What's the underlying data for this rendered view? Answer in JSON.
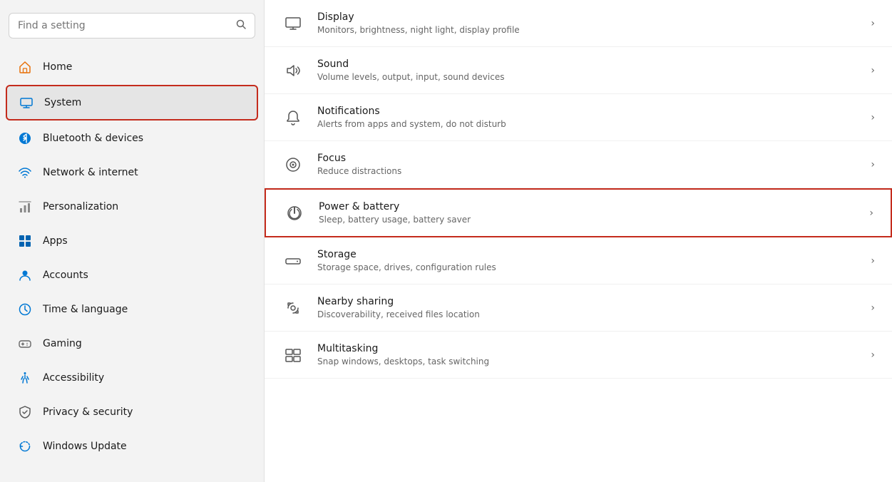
{
  "search": {
    "placeholder": "Find a setting"
  },
  "sidebar": {
    "items": [
      {
        "id": "home",
        "label": "Home",
        "icon": "home"
      },
      {
        "id": "system",
        "label": "System",
        "icon": "system",
        "active": true
      },
      {
        "id": "bluetooth",
        "label": "Bluetooth & devices",
        "icon": "bluetooth"
      },
      {
        "id": "network",
        "label": "Network & internet",
        "icon": "network"
      },
      {
        "id": "personalization",
        "label": "Personalization",
        "icon": "personalization"
      },
      {
        "id": "apps",
        "label": "Apps",
        "icon": "apps"
      },
      {
        "id": "accounts",
        "label": "Accounts",
        "icon": "accounts"
      },
      {
        "id": "time",
        "label": "Time & language",
        "icon": "time"
      },
      {
        "id": "gaming",
        "label": "Gaming",
        "icon": "gaming"
      },
      {
        "id": "accessibility",
        "label": "Accessibility",
        "icon": "accessibility"
      },
      {
        "id": "privacy",
        "label": "Privacy & security",
        "icon": "privacy"
      },
      {
        "id": "update",
        "label": "Windows Update",
        "icon": "update"
      }
    ]
  },
  "main": {
    "items": [
      {
        "id": "display",
        "title": "Display",
        "subtitle": "Monitors, brightness, night light, display profile"
      },
      {
        "id": "sound",
        "title": "Sound",
        "subtitle": "Volume levels, output, input, sound devices"
      },
      {
        "id": "notifications",
        "title": "Notifications",
        "subtitle": "Alerts from apps and system, do not disturb"
      },
      {
        "id": "focus",
        "title": "Focus",
        "subtitle": "Reduce distractions"
      },
      {
        "id": "power",
        "title": "Power & battery",
        "subtitle": "Sleep, battery usage, battery saver",
        "highlighted": true
      },
      {
        "id": "storage",
        "title": "Storage",
        "subtitle": "Storage space, drives, configuration rules"
      },
      {
        "id": "nearby",
        "title": "Nearby sharing",
        "subtitle": "Discoverability, received files location"
      },
      {
        "id": "multitasking",
        "title": "Multitasking",
        "subtitle": "Snap windows, desktops, task switching"
      }
    ]
  }
}
